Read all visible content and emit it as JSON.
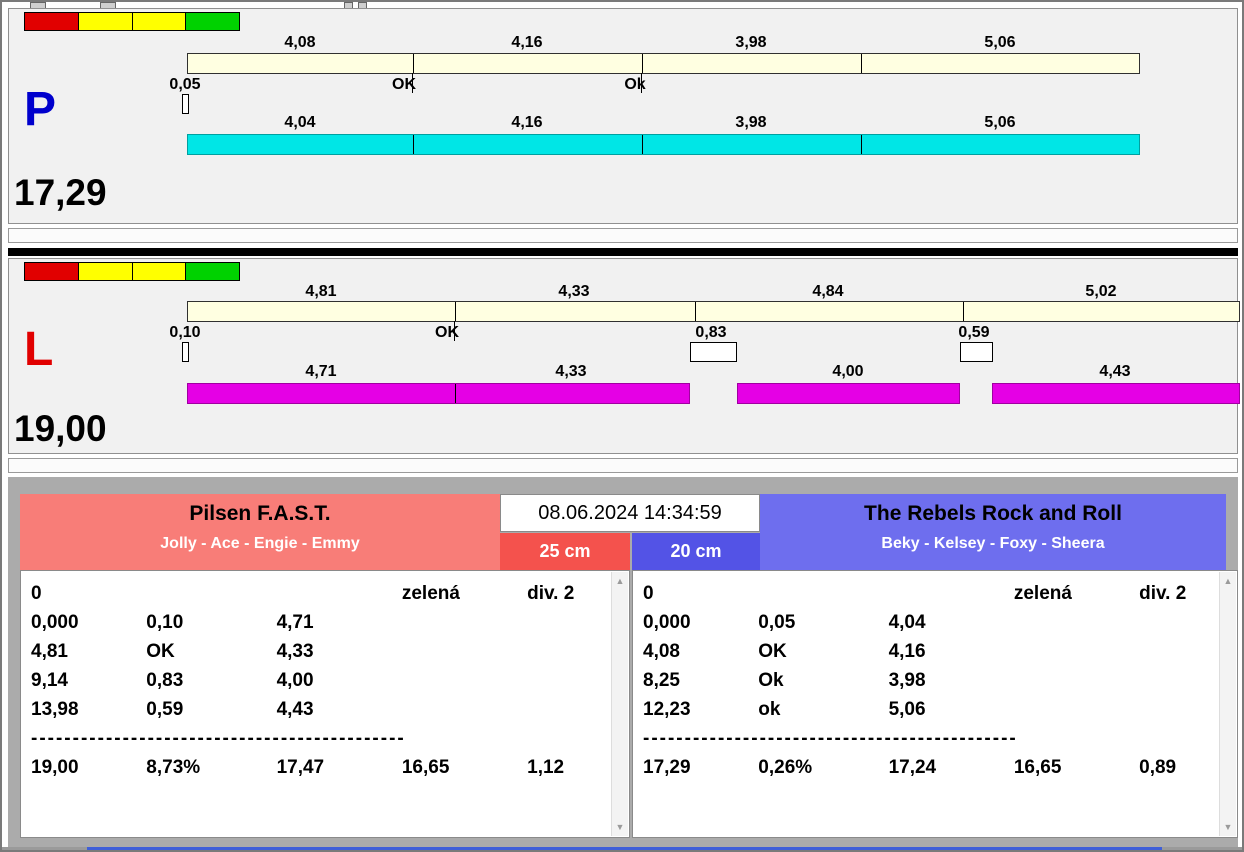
{
  "colors": {
    "cyan_bar": "#00e6e6",
    "magenta_bar": "#e500e5",
    "cream_bar": "#ffffe1",
    "left_header_bg": "#f87d78",
    "right_header_bg": "#6e6eee",
    "left_height_bg": "#f4524d",
    "right_height_bg": "#5353e6",
    "lane_p_letter": "#0000cd",
    "lane_l_letter": "#e10000"
  },
  "datetime": "08.06.2024 14:34:59",
  "lane_p": {
    "letter": "P",
    "total": "17,29",
    "crossing_splits": [
      "4,08",
      "4,16",
      "3,98",
      "5,06"
    ],
    "start_offset": "0,05",
    "marker_1": "OK",
    "marker_2": "Ok",
    "dog_times": [
      "4,04",
      "4,16",
      "3,98",
      "5,06"
    ]
  },
  "lane_l": {
    "letter": "L",
    "total": "19,00",
    "crossing_splits": [
      "4,81",
      "4,33",
      "4,84",
      "5,02"
    ],
    "start_offset": "0,10",
    "marker_1": "OK",
    "marker_2": "0,83",
    "marker_3": "0,59",
    "dog_times": [
      "4,71",
      "4,33",
      "4,00",
      "4,43"
    ]
  },
  "left_team": {
    "name": "Pilsen F.A.S.T.",
    "dogs": "Jolly - Ace - Engie - Emmy",
    "height": "25 cm",
    "table": {
      "row0": [
        "0",
        "zelená",
        "div. 2"
      ],
      "rows": [
        [
          "0,000",
          "0,10",
          "4,71"
        ],
        [
          "4,81",
          "OK",
          "4,33"
        ],
        [
          "9,14",
          "0,83",
          "4,00"
        ],
        [
          "13,98",
          "0,59",
          "4,43"
        ]
      ],
      "separator": "---------------------------------------------",
      "totals": [
        "19,00",
        "8,73%",
        "17,47",
        "16,65",
        "1,12"
      ]
    }
  },
  "right_team": {
    "name": "The Rebels Rock and Roll",
    "dogs": "Beky - Kelsey - Foxy - Sheera",
    "height": "20 cm",
    "table": {
      "row0": [
        "0",
        "zelená",
        "div. 2"
      ],
      "rows": [
        [
          "0,000",
          "0,05",
          "4,04"
        ],
        [
          "4,08",
          "OK",
          "4,16"
        ],
        [
          "8,25",
          "Ok",
          "3,98"
        ],
        [
          "12,23",
          "ok",
          "5,06"
        ]
      ],
      "separator": "---------------------------------------------",
      "totals": [
        "17,29",
        "0,26%",
        "17,24",
        "16,65",
        "0,89"
      ]
    }
  }
}
